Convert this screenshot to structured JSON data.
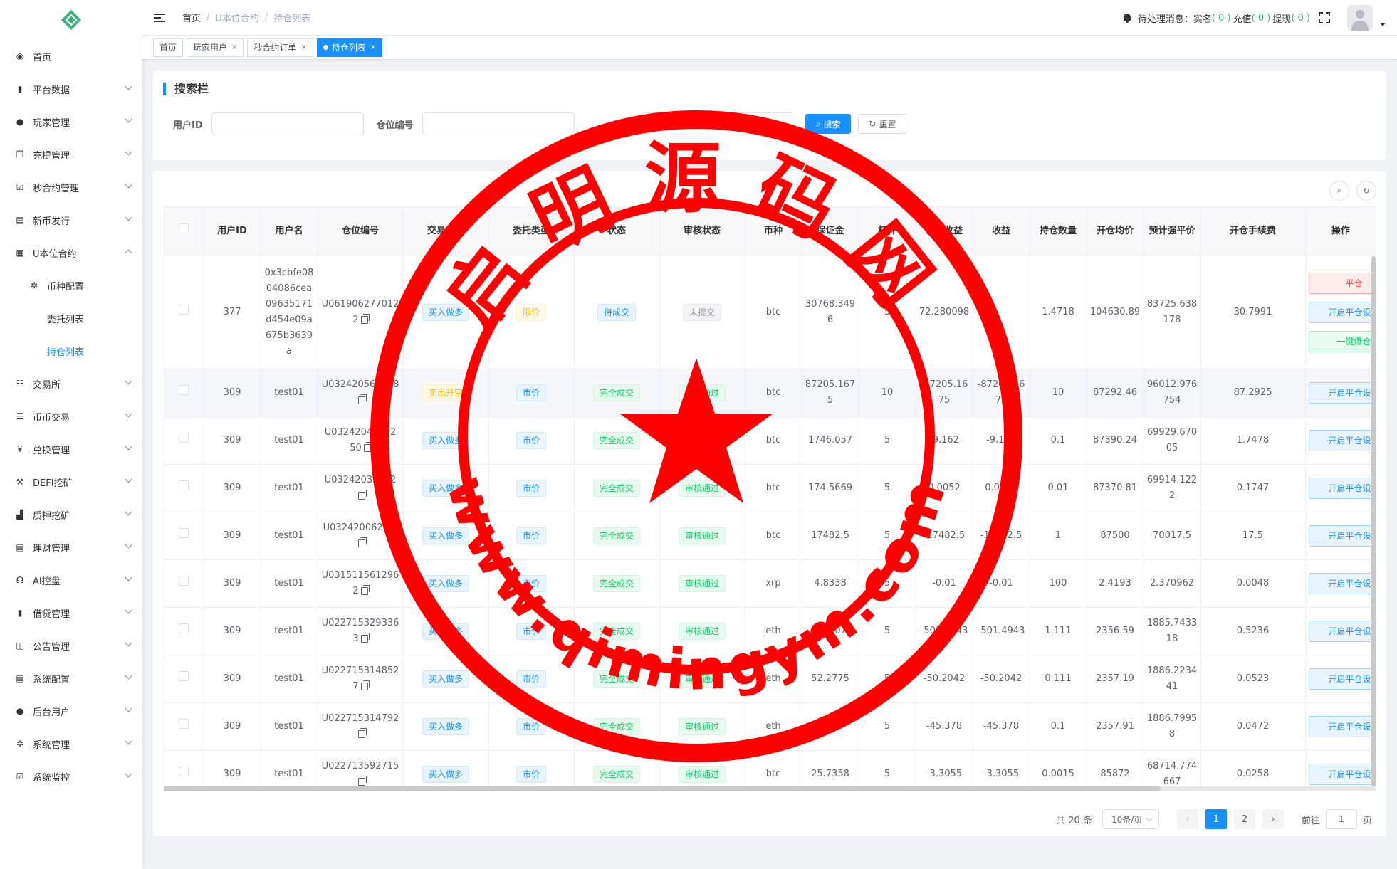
{
  "sidebar": {
    "items": [
      {
        "label": "首页",
        "icon": "dashboard-icon",
        "glyph": "◉",
        "arrow": ""
      },
      {
        "label": "平台数据",
        "icon": "book-icon",
        "glyph": "▮",
        "arrow": "down"
      },
      {
        "label": "玩家管理",
        "icon": "user-icon",
        "glyph": "●",
        "arrow": "down"
      },
      {
        "label": "充提管理",
        "icon": "copy-icon",
        "glyph": "❐",
        "arrow": "down"
      },
      {
        "label": "秒合约管理",
        "icon": "monitor-icon",
        "glyph": "☑",
        "arrow": "down"
      },
      {
        "label": "新币发行",
        "icon": "list-icon",
        "glyph": "▤",
        "arrow": "down"
      },
      {
        "label": "U本位合约",
        "icon": "grid-icon",
        "glyph": "▦",
        "arrow": "up"
      },
      {
        "label": "币种配置",
        "icon": "gear-icon",
        "glyph": "✲",
        "arrow": "",
        "level": 1
      },
      {
        "label": "委托列表",
        "icon": "",
        "glyph": "",
        "arrow": "",
        "level": 2
      },
      {
        "label": "持仓列表",
        "icon": "",
        "glyph": "",
        "arrow": "",
        "level": 2,
        "active": true
      },
      {
        "label": "交易所",
        "icon": "list-check-icon",
        "glyph": "☷",
        "arrow": "down"
      },
      {
        "label": "币币交易",
        "icon": "list-icon",
        "glyph": "☰",
        "arrow": "down"
      },
      {
        "label": "兑换管理",
        "icon": "yen-icon",
        "glyph": "¥",
        "arrow": "down"
      },
      {
        "label": "DEFI挖矿",
        "icon": "pickaxe-icon",
        "glyph": "⚒",
        "arrow": "down"
      },
      {
        "label": "质押挖矿",
        "icon": "bar-chart-icon",
        "glyph": "▟",
        "arrow": "down"
      },
      {
        "label": "理财管理",
        "icon": "document-icon",
        "glyph": "▤",
        "arrow": "down"
      },
      {
        "label": "AI控盘",
        "icon": "headset-icon",
        "glyph": "☊",
        "arrow": "down"
      },
      {
        "label": "借贷管理",
        "icon": "book-icon",
        "glyph": "▮",
        "arrow": "down"
      },
      {
        "label": "公告管理",
        "icon": "open-book-icon",
        "glyph": "◫",
        "arrow": "down"
      },
      {
        "label": "系统配置",
        "icon": "document-icon",
        "glyph": "▤",
        "arrow": "down"
      },
      {
        "label": "后台用户",
        "icon": "users-icon",
        "glyph": "●",
        "arrow": "down"
      },
      {
        "label": "系统管理",
        "icon": "gear-icon",
        "glyph": "✲",
        "arrow": "down"
      },
      {
        "label": "系统监控",
        "icon": "monitor-icon",
        "glyph": "☑",
        "arrow": "down"
      }
    ]
  },
  "header": {
    "breadcrumb": [
      "首页",
      "U本位合约",
      "持仓列表"
    ],
    "pending_label": "待处理消息：",
    "realname_label": "实名",
    "realname_count": "( 0 )",
    "recharge_label": "充值",
    "recharge_count": "( 0 )",
    "withdraw_label": "提现",
    "withdraw_count": "( 0 )"
  },
  "tags": [
    {
      "label": "首页",
      "closable": false,
      "active": false
    },
    {
      "label": "玩家用户",
      "closable": true,
      "active": false
    },
    {
      "label": "秒合约订单",
      "closable": true,
      "active": false
    },
    {
      "label": "持仓列表",
      "closable": true,
      "active": true
    }
  ],
  "search": {
    "title": "搜索栏",
    "user_id_label": "用户ID",
    "position_no_label": "仓位编号",
    "select_placeholder": "请选择",
    "search_btn": "搜索",
    "reset_btn": "重置"
  },
  "table": {
    "columns": [
      "用户ID",
      "用户名",
      "仓位编号",
      "交易类型",
      "委托类型",
      "状态",
      "审核状态",
      "币种",
      "保证金",
      "杠杆",
      "当前收益",
      "收益",
      "持仓数量",
      "开仓均价",
      "预计强平价",
      "开仓手续费",
      "操作"
    ],
    "rows": [
      {
        "user_id": "377",
        "username": "0x3cbfe0804086cea09635171d454e09a675b3639a",
        "position_no": "U0619062770122",
        "trade_type": "买入做多",
        "trade_color": "blue",
        "order_type": "限价",
        "order_color": "yellow",
        "status": "待成交",
        "status_color": "blue",
        "audit": "未提交",
        "audit_color": "gray",
        "coin": "btc",
        "margin": "30768.3496",
        "leverage": "5",
        "current_profit": "72.280098",
        "profit": "",
        "qty": "1.4718",
        "avg_price": "104630.89",
        "liq_price": "83725.638178",
        "fee": "30.7991",
        "actions": [
          {
            "label": "平仓",
            "color": "red"
          },
          {
            "label": "开启平仓设置",
            "color": "blue"
          },
          {
            "label": "一键爆仓",
            "color": "green"
          }
        ]
      },
      {
        "user_id": "309",
        "username": "test01",
        "position_no": "U032420563678",
        "trade_type": "卖出开空",
        "trade_color": "yellow",
        "order_type": "市价",
        "order_color": "blue",
        "status": "完全成交",
        "status_color": "green",
        "audit": "审核通过",
        "audit_color": "green",
        "coin": "btc",
        "margin": "87205.1675",
        "leverage": "10",
        "current_profit": "-87205.1675",
        "profit": "-87205.1675",
        "qty": "10",
        "avg_price": "87292.46",
        "liq_price": "96012.976754",
        "fee": "87.2925",
        "actions": [
          {
            "label": "开启平仓设置",
            "color": "blue"
          }
        ]
      },
      {
        "user_id": "309",
        "username": "test01",
        "position_no": "U03242040022 50",
        "trade_type": "买入做多",
        "trade_color": "blue",
        "order_type": "市价",
        "order_color": "blue",
        "status": "完全成交",
        "status_color": "green",
        "audit": "审核通过",
        "audit_color": "green",
        "coin": "btc",
        "margin": "1746.057",
        "leverage": "5",
        "current_profit": "-9.162",
        "profit": "-9.162",
        "qty": "0.1",
        "avg_price": "87390.24",
        "liq_price": "69929.67005",
        "fee": "1.7478",
        "actions": [
          {
            "label": "开启平仓设置",
            "color": "blue"
          }
        ]
      },
      {
        "user_id": "309",
        "username": "test01",
        "position_no": "U03242035352",
        "trade_type": "买入做多",
        "trade_color": "blue",
        "order_type": "市价",
        "order_color": "blue",
        "status": "完全成交",
        "status_color": "green",
        "audit": "审核通过",
        "audit_color": "green",
        "coin": "btc",
        "margin": "174.5669",
        "leverage": "5",
        "current_profit": "0.0052",
        "profit": "0.0052",
        "qty": "0.01",
        "avg_price": "87370.81",
        "liq_price": "69914.1222",
        "fee": "0.1747",
        "actions": [
          {
            "label": "开启平仓设置",
            "color": "blue"
          }
        ]
      },
      {
        "user_id": "309",
        "username": "test01",
        "position_no": "U032420062 72",
        "trade_type": "买入做多",
        "trade_color": "blue",
        "order_type": "市价",
        "order_color": "blue",
        "status": "完全成交",
        "status_color": "green",
        "audit": "审核通过",
        "audit_color": "green",
        "coin": "btc",
        "margin": "17482.5",
        "leverage": "5",
        "current_profit": "-17482.5",
        "profit": "-17482.5",
        "qty": "1",
        "avg_price": "87500",
        "liq_price": "70017.5",
        "fee": "17.5",
        "actions": [
          {
            "label": "开启平仓设置",
            "color": "blue"
          }
        ]
      },
      {
        "user_id": "309",
        "username": "test01",
        "position_no": "U0315115612962",
        "trade_type": "买入做多",
        "trade_color": "blue",
        "order_type": "市价",
        "order_color": "blue",
        "status": "完全成交",
        "status_color": "green",
        "audit": "审核通过",
        "audit_color": "green",
        "coin": "xrp",
        "margin": "4.8338",
        "leverage": "5",
        "current_profit": "-0.01",
        "profit": "-0.01",
        "qty": "100",
        "avg_price": "2.4193",
        "liq_price": "2.370962",
        "fee": "0.0048",
        "actions": [
          {
            "label": "开启平仓设置",
            "color": "blue"
          }
        ]
      },
      {
        "user_id": "309",
        "username": "test01",
        "position_no": "U0227153293363",
        "trade_type": "买入做多",
        "trade_color": "blue",
        "order_type": "市价",
        "order_color": "blue",
        "status": "完全成交",
        "status_color": "green",
        "audit": "审核通过",
        "audit_color": "green",
        "coin": "eth",
        "margin": "523.07",
        "leverage": "5",
        "current_profit": "-501.4943",
        "profit": "-501.4943",
        "qty": "1.111",
        "avg_price": "2356.59",
        "liq_price": "1885.743318",
        "fee": "0.5236",
        "actions": [
          {
            "label": "开启平仓设置",
            "color": "blue"
          }
        ]
      },
      {
        "user_id": "309",
        "username": "test01",
        "position_no": "U0227153148527",
        "trade_type": "买入做多",
        "trade_color": "blue",
        "order_type": "市价",
        "order_color": "blue",
        "status": "完全成交",
        "status_color": "green",
        "audit": "审核通过",
        "audit_color": "green",
        "coin": "eth",
        "margin": "52.2775",
        "leverage": "5",
        "current_profit": "-50.2042",
        "profit": "-50.2042",
        "qty": "0.111",
        "avg_price": "2357.19",
        "liq_price": "1886.223441",
        "fee": "0.0523",
        "actions": [
          {
            "label": "开启平仓设置",
            "color": "blue"
          }
        ]
      },
      {
        "user_id": "309",
        "username": "test01",
        "position_no": "U022715314792",
        "trade_type": "买入做多",
        "trade_color": "blue",
        "order_type": "市价",
        "order_color": "blue",
        "status": "完全成交",
        "status_color": "green",
        "audit": "审核通过",
        "audit_color": "green",
        "coin": "eth",
        "margin": "47.1",
        "leverage": "5",
        "current_profit": "-45.378",
        "profit": "-45.378",
        "qty": "0.1",
        "avg_price": "2357.91",
        "liq_price": "1886.79958",
        "fee": "0.0472",
        "actions": [
          {
            "label": "开启平仓设置",
            "color": "blue"
          }
        ]
      },
      {
        "user_id": "309",
        "username": "test01",
        "position_no": "U022713592715",
        "trade_type": "买入做多",
        "trade_color": "blue",
        "order_type": "市价",
        "order_color": "blue",
        "status": "完全成交",
        "status_color": "green",
        "audit": "审核通过",
        "audit_color": "green",
        "coin": "btc",
        "margin": "25.7358",
        "leverage": "5",
        "current_profit": "-3.3055",
        "profit": "-3.3055",
        "qty": "0.0015",
        "avg_price": "85872",
        "liq_price": "68714.774667",
        "fee": "0.0258",
        "actions": [
          {
            "label": "开启平仓设置",
            "color": "blue"
          }
        ]
      }
    ]
  },
  "pagination": {
    "total": "共 20 条",
    "page_size": "10条/页",
    "pages": [
      "1",
      "2"
    ],
    "current": "1",
    "goto_label": "前往",
    "goto_value": "1",
    "page_suffix": "页"
  },
  "watermark": {
    "title": "启明源码网",
    "url": "www.qimingym.com",
    "color": "#ff0000"
  }
}
